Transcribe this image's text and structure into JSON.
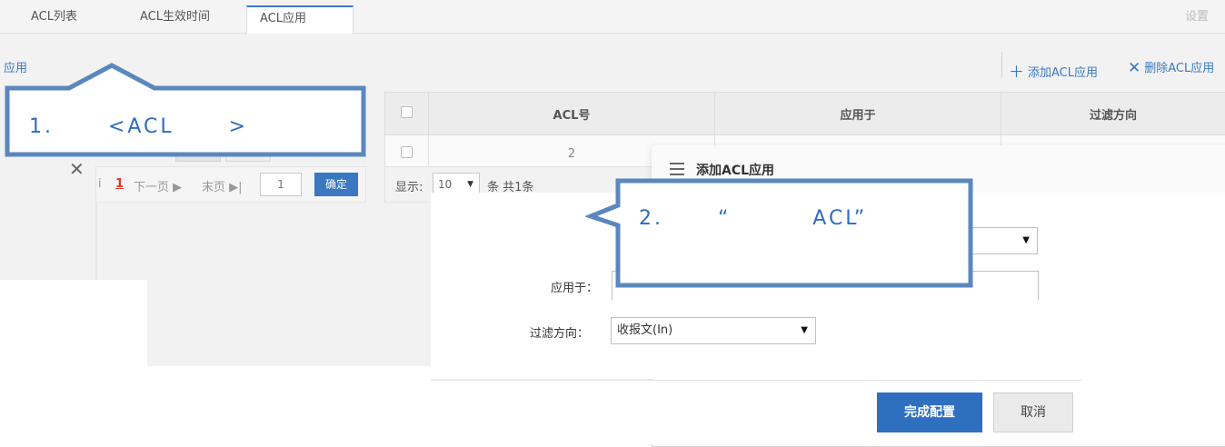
{
  "tabs": [
    {
      "label": "ACL列表"
    },
    {
      "label": "ACL生效时间"
    },
    {
      "label": "ACL应用"
    },
    {
      "label": "设置"
    }
  ],
  "left_link": "应用",
  "toolbar": {
    "add_label": "添加ACL应用",
    "add_icon": "plus-icon",
    "delete_label": "删除ACL应用",
    "delete_icon": "close-icon"
  },
  "table": {
    "headers": [
      "ACL号",
      "应用于",
      "过滤方向"
    ],
    "rows": [
      {
        "acl": "2",
        "applied_to": "",
        "direction": ""
      }
    ]
  },
  "table_footer": {
    "show_label": "显示:",
    "page_size": "10",
    "total_text": "条 共1条"
  },
  "pager": {
    "current_page": "1",
    "next_label": "下一页 ▶",
    "last_label": "末页 ▶|",
    "page_input": "1",
    "confirm_label": "确定"
  },
  "modal": {
    "title": "添加ACL应用",
    "fields": {
      "applied_to_label": "应用于：",
      "direction_label": "过滤方向：",
      "direction_value": "收报文(In)"
    },
    "submit_label": "完成配置",
    "cancel_label": "取消"
  },
  "callouts": [
    {
      "text": "1.      <ACL      >"
    },
    {
      "text": "2.      “         ACL”"
    }
  ],
  "colors": {
    "accent": "#3a78c2",
    "primary_button": "#2f6fc0",
    "callout_border": "#5b87bd",
    "current_page": "#d9382c"
  }
}
